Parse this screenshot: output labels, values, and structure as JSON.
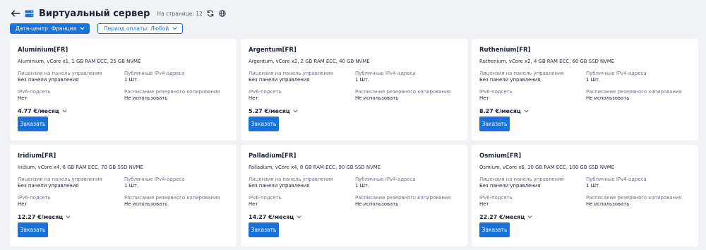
{
  "header": {
    "title": "Виртуальный сервер",
    "per_page": "На странице: 12",
    "icons": [
      "back-arrow-icon",
      "server-icon",
      "refresh-icon",
      "globe-icon"
    ]
  },
  "filters": {
    "datacenter": "Дата-центр: Франция",
    "period": "Период оплаты: Любой"
  },
  "colors": {
    "accent": "#1a72d8",
    "background": "#f1f2f5",
    "card": "#ffffff"
  },
  "labels": {
    "license": "Лицензия на панель управления",
    "ipv4": "Публичные IPv4-адреса",
    "ipv6": "IPv6-подсеть",
    "backup": "Расписание резервного копирования",
    "order": "Заказать"
  },
  "cards": [
    {
      "title": "Aluminium[FR]",
      "spec": "Aluminium, vCore x1, 1 GB RAM ECC, 25 GB NVME",
      "license": "Без панели управления",
      "ipv4": "1 Шт.",
      "ipv6": "Нет",
      "backup": "Не использовать",
      "price": "4.77 €/месяц"
    },
    {
      "title": "Argentum[FR]",
      "spec": "Argentum, vCore x2, 2 GB RAM ECC, 40 GB NVME",
      "license": "Без панели управления",
      "ipv4": "1 Шт.",
      "ipv6": "Нет",
      "backup": "Не использовать",
      "price": "5.27 €/месяц"
    },
    {
      "title": "Ruthenium[FR]",
      "spec": "Ruthenium, vCore x2, 4 GB RAM ECC, 60 GB SSD NVME",
      "license": "Без панели управления",
      "ipv4": "1 Шт.",
      "ipv6": "Нет",
      "backup": "Не использовать",
      "price": "8.27 €/месяц"
    },
    {
      "title": "Iridium[FR]",
      "spec": "Iridium, vCore x4, 6 GB RAM ECC, 70 GB SSD NVME",
      "license": "Без панели управления",
      "ipv4": "1 Шт.",
      "ipv6": "Нет",
      "backup": "Не использовать",
      "price": "12.27 €/месяц"
    },
    {
      "title": "Palladium[FR]",
      "spec": "Palladium, vCore x4, 8 GB RAM ECC, 90 GB SSD NVME",
      "license": "Без панели управления",
      "ipv4": "1 Шт.",
      "ipv6": "Нет",
      "backup": "Не использовать",
      "price": "14.27 €/месяц"
    },
    {
      "title": "Osmium[FR]",
      "spec": "Osmium, vCore x6, 10 GB RAM ECC, 100 GB SSD NVME",
      "license": "Без панели управления",
      "ipv4": "1 Шт.",
      "ipv6": "Нет",
      "backup": "Не использовать",
      "price": "22.27 €/месяц"
    }
  ]
}
